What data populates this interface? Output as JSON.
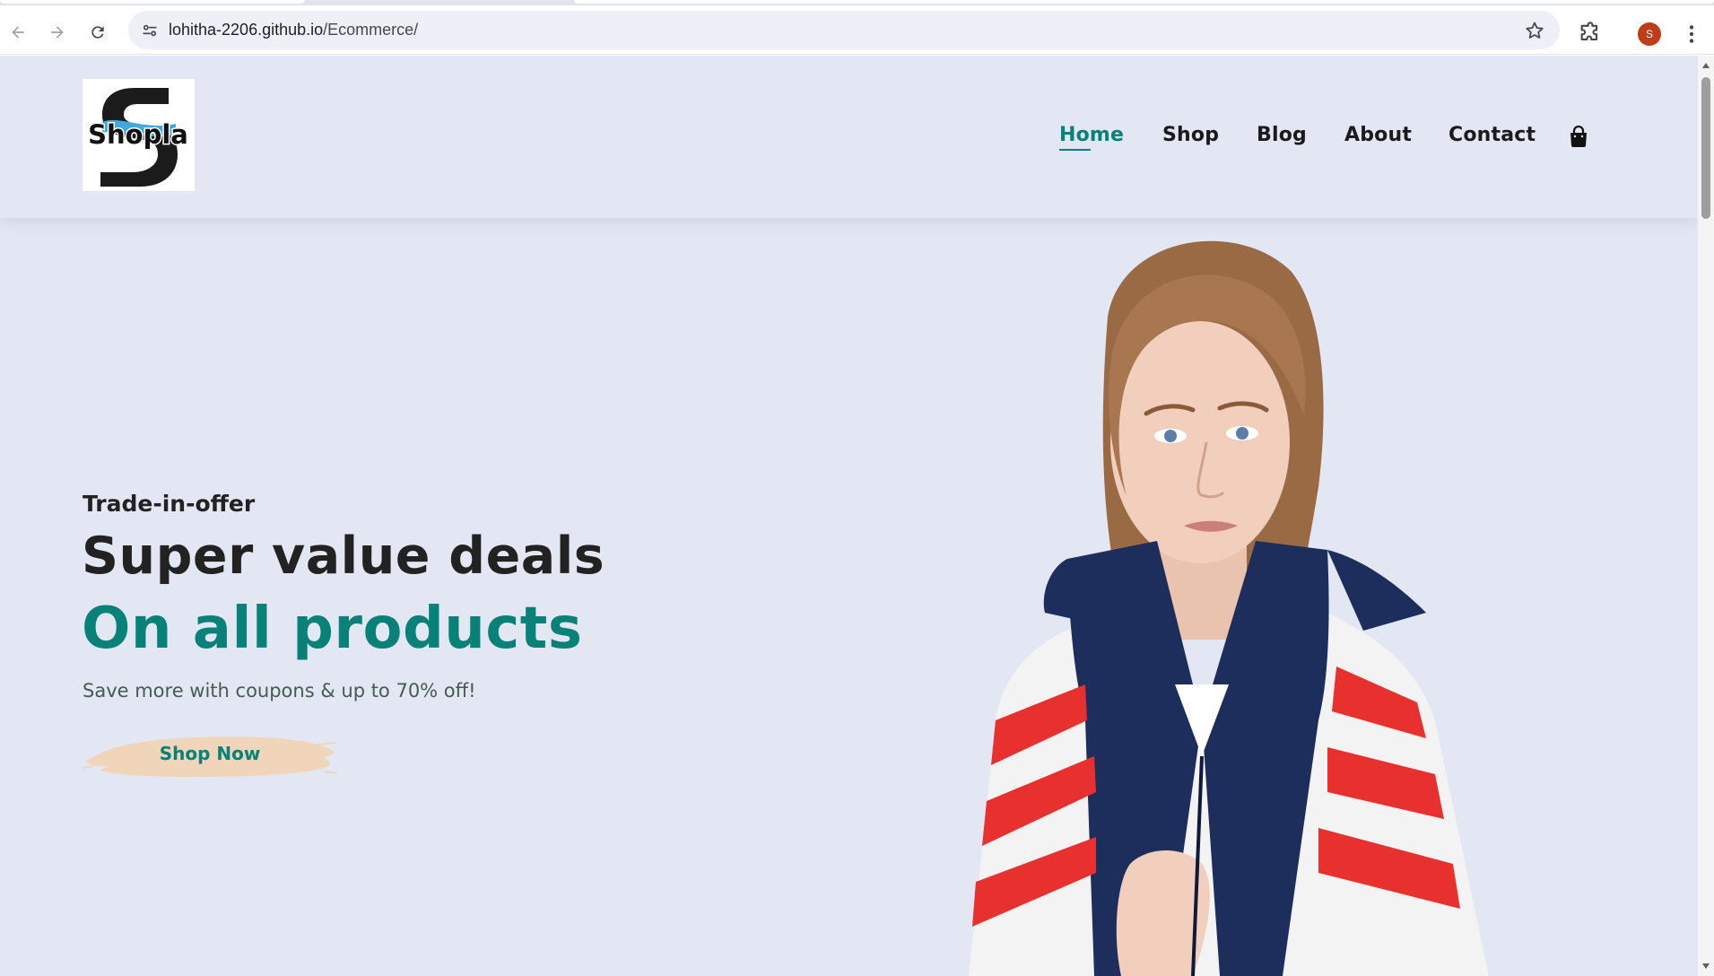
{
  "browser": {
    "url_host": "lohitha-2206.github.io",
    "url_path": "/Ecommerce/",
    "profile_initial": "S",
    "icons": {
      "back": "arrow-left-icon",
      "forward": "arrow-right-icon",
      "reload": "reload-icon",
      "site_info": "tune-icon",
      "bookmark": "star-icon",
      "extensions": "puzzle-icon",
      "menu": "kebab-menu-icon"
    }
  },
  "site": {
    "logo_text": "Shopla",
    "nav": [
      {
        "label": "Home",
        "active": true
      },
      {
        "label": "Shop",
        "active": false
      },
      {
        "label": "Blog",
        "active": false
      },
      {
        "label": "About",
        "active": false
      },
      {
        "label": "Contact",
        "active": false
      }
    ],
    "cart_icon": "shopping-bag-icon"
  },
  "hero": {
    "kicker": "Trade-in-offer",
    "headline": "Super value deals",
    "headline_accent": "On all products",
    "subtext": "Save more with coupons & up to 70% off!",
    "cta_label": "Shop Now"
  },
  "colors": {
    "accent": "#088178",
    "page_bg": "#e3e6f3",
    "button_bg": "#f0d5bb",
    "text_dark": "#222222"
  }
}
